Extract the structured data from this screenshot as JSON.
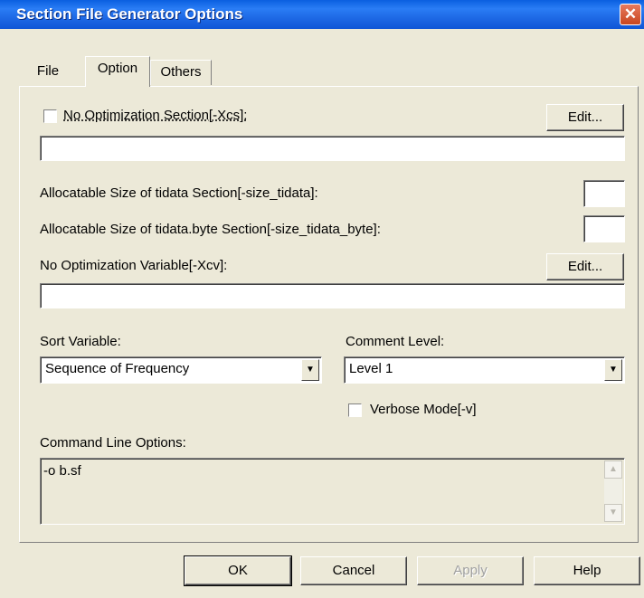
{
  "window": {
    "title": "Section File Generator Options",
    "close_glyph": "✕"
  },
  "tabs": [
    {
      "label": "File"
    },
    {
      "label": "Option"
    },
    {
      "label": "Others"
    }
  ],
  "option": {
    "no_opt_section": {
      "label": "No Optimization Section[-Xcs]:",
      "checked": false,
      "edit_label": "Edit...",
      "value": ""
    },
    "tidata_label": "Allocatable Size of tidata Section[-size_tidata]:",
    "tidata_value": "",
    "tidata_byte_label": "Allocatable Size of tidata.byte Section[-size_tidata_byte]:",
    "tidata_byte_value": "",
    "no_opt_variable": {
      "label": "No Optimization Variable[-Xcv]:",
      "edit_label": "Edit...",
      "value": ""
    },
    "sort_variable": {
      "label": "Sort Variable:",
      "selected": "Sequence of Frequency"
    },
    "comment_level": {
      "label": "Comment Level:",
      "selected": "Level 1"
    },
    "verbose": {
      "label": "Verbose Mode[-v]",
      "checked": false
    },
    "command_line": {
      "label": "Command Line Options:",
      "value": "-o b.sf"
    }
  },
  "buttons": {
    "ok": "OK",
    "cancel": "Cancel",
    "apply": "Apply",
    "help": "Help"
  },
  "icons": {
    "dropdown": "▼",
    "scroll_up": "▲",
    "scroll_down": "▼"
  },
  "colors": {
    "titlebar": "#0a5fe0",
    "face": "#ece9d8",
    "close": "#c8461f"
  }
}
